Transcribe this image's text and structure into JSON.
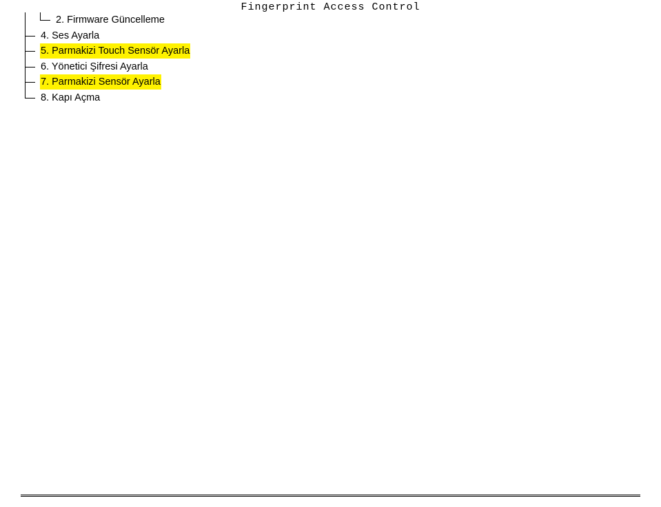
{
  "header": {
    "title": "Fingerprint Access Control"
  },
  "tree": {
    "items": [
      {
        "num": "2.",
        "text": "Firmware Güncelleme",
        "highlight": false
      },
      {
        "num": "4.",
        "text": "Ses Ayarla",
        "highlight": false
      },
      {
        "num": "5.",
        "text": "Parmakizi Touch Sensör Ayarla",
        "highlight": true
      },
      {
        "num": "6.",
        "text": "Yönetici Şifresi Ayarla",
        "highlight": false
      },
      {
        "num": "7.",
        "text": "Parmakizi Sensör Ayarla",
        "highlight": true
      },
      {
        "num": "8.",
        "text": "Kapı Açma",
        "highlight": false
      }
    ]
  }
}
